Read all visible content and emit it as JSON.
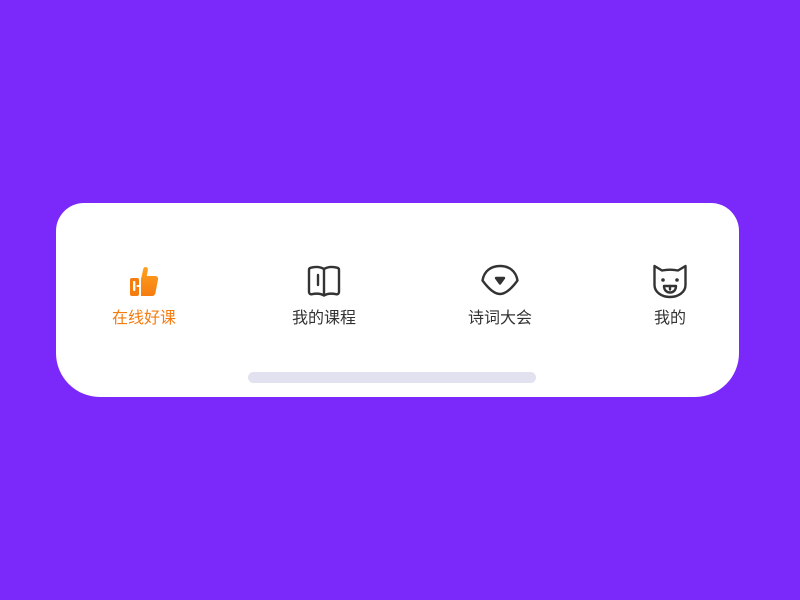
{
  "colors": {
    "background": "#7b29fb",
    "tabbar_bg": "#ffffff",
    "active": "#f57c0f",
    "active_light": "#ffa020",
    "inactive": "#333333",
    "home_indicator": "#e2e1f0"
  },
  "tabbar": {
    "active_index": 0,
    "tabs": [
      {
        "label": "在线好课",
        "icon": "thumbs-up-icon"
      },
      {
        "label": "我的课程",
        "icon": "book-icon"
      },
      {
        "label": "诗词大会",
        "icon": "dumpling-icon"
      },
      {
        "label": "我的",
        "icon": "cat-face-icon"
      }
    ]
  }
}
